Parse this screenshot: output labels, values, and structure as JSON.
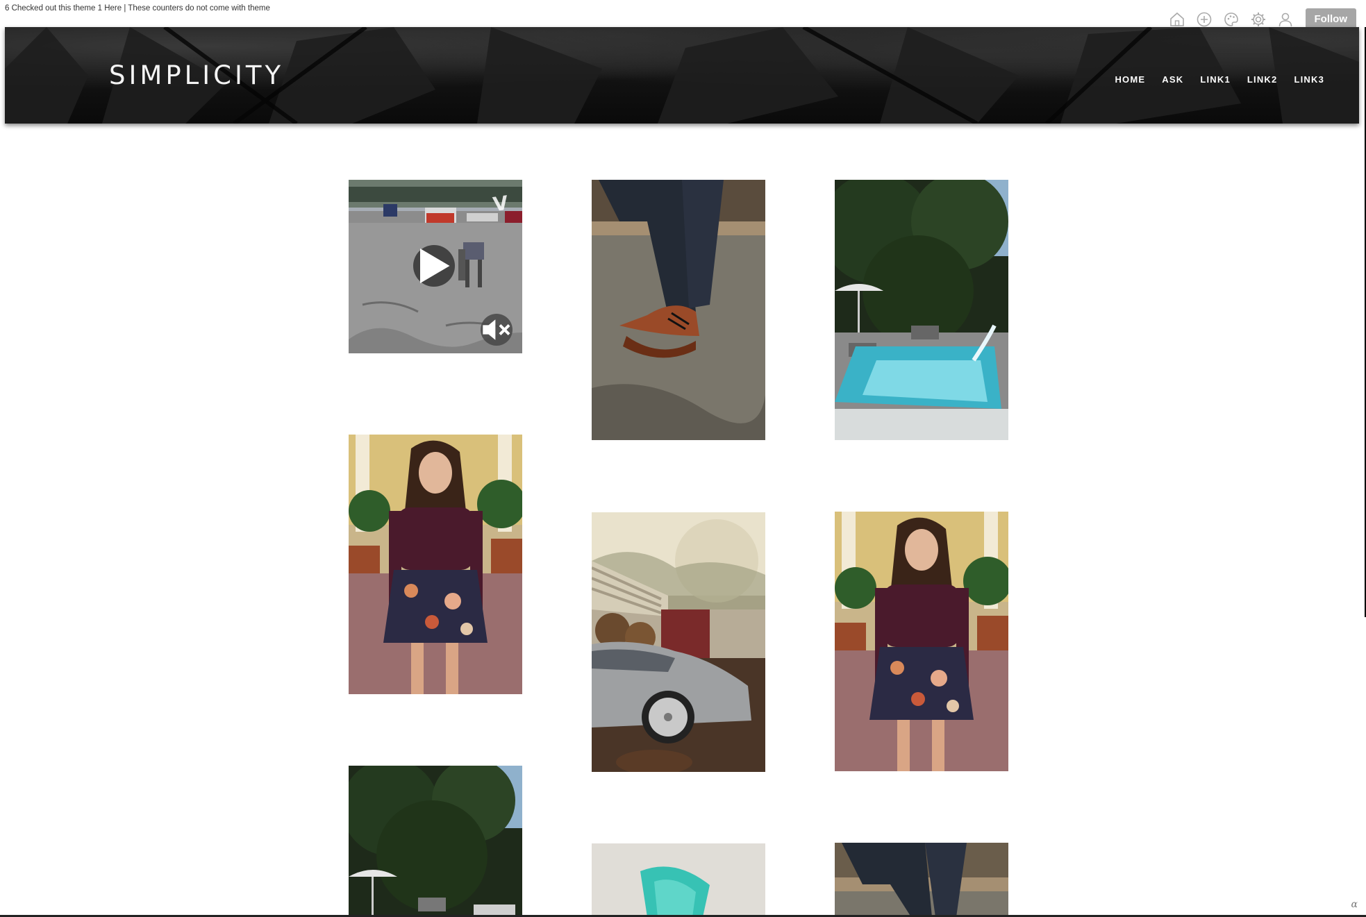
{
  "topbar": {
    "counter_text": "6 Checked out this theme 1 Here | These counters do not come with theme"
  },
  "controls": {
    "icons": [
      "home-icon",
      "add-post-icon",
      "palette-icon",
      "gear-icon",
      "user-icon"
    ],
    "follow_label": "Follow"
  },
  "header": {
    "title": "SIMPLICITY",
    "nav": [
      "HOME",
      "ASK",
      "LINK1",
      "LINK2",
      "LINK3"
    ]
  },
  "posts": [
    {
      "type": "video",
      "subject": "robot dog in parking lot",
      "vine_label": "V"
    },
    {
      "type": "photo",
      "subject": "brown boots on concrete ledge"
    },
    {
      "type": "photo",
      "subject": "pool with fountain and trees"
    },
    {
      "type": "photo",
      "subject": "woman in floral skirt"
    },
    {
      "type": "photo",
      "subject": "silver sports car"
    },
    {
      "type": "photo",
      "subject": "woman in floral skirt"
    },
    {
      "type": "photo",
      "subject": "pool with trees"
    },
    {
      "type": "photo",
      "subject": "turquoise object"
    },
    {
      "type": "photo",
      "subject": "jeans on wooden ledge"
    }
  ],
  "colors": {
    "header_bg": "#0d0d0d",
    "follow_bg": "#a6a6a6",
    "title": "#f4f4f4"
  },
  "footer_logo": "ɑ"
}
